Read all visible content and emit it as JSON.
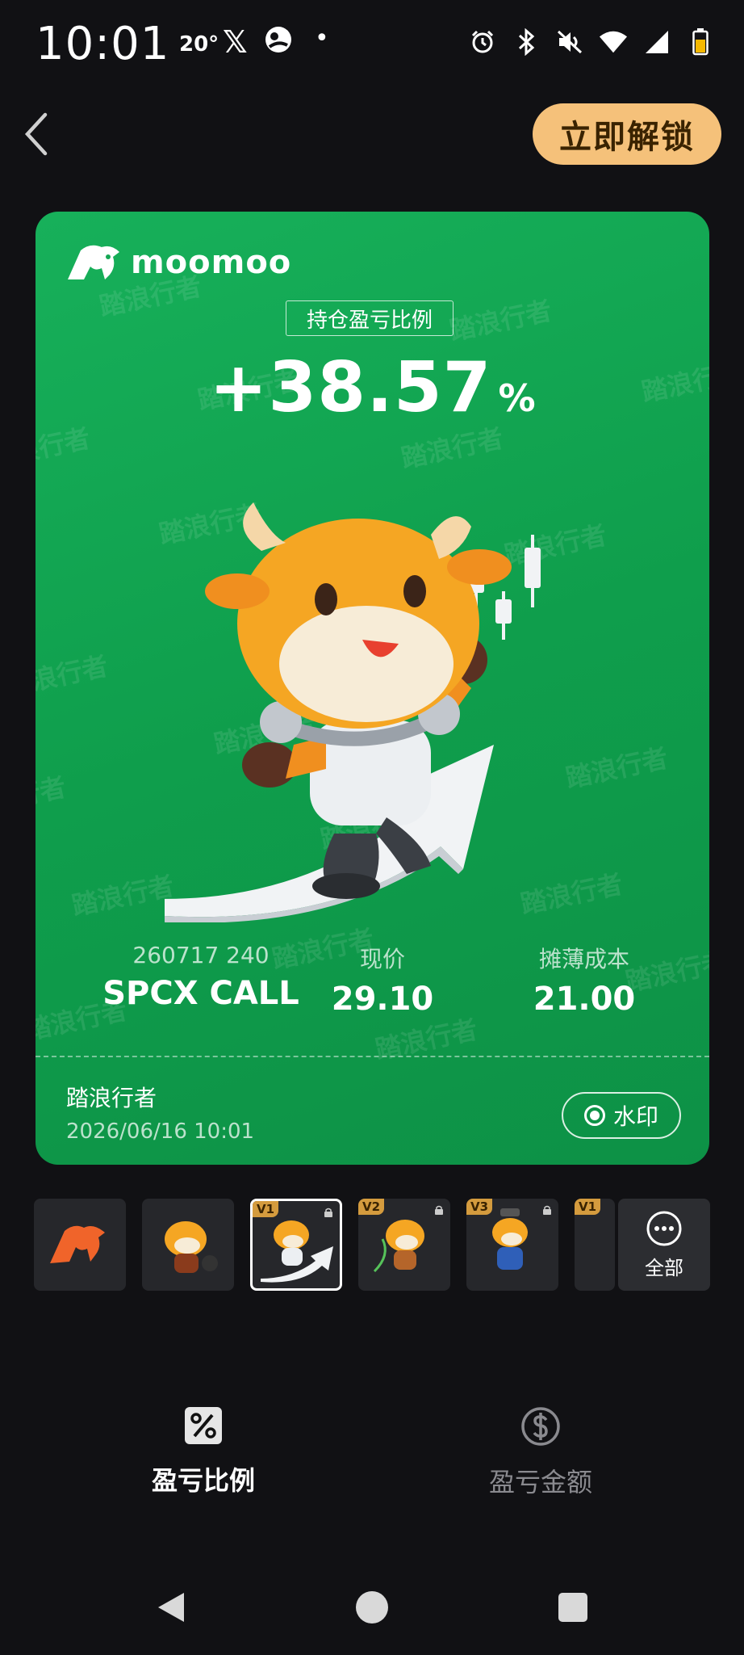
{
  "status_bar": {
    "time": "10:01",
    "temperature": "20°",
    "x_icon": "𝕏",
    "dot": "•"
  },
  "header": {
    "unlock_label": "立即解锁"
  },
  "card": {
    "brand": "moomoo",
    "ratio_label": "持仓盈亏比例",
    "ratio_value": "+38.57",
    "ratio_unit": "%",
    "watermark_text": "踏浪行者",
    "contract_code": "260717 240",
    "contract_name": "SPCX CALL",
    "current_price_label": "现价",
    "current_price": "29.10",
    "cost_label": "摊薄成本",
    "cost_value": "21.00",
    "user_name": "踏浪行者",
    "timestamp": "2026/06/16 10:01",
    "watermark_toggle_label": "水印"
  },
  "templates": {
    "items": [
      {
        "badge": ""
      },
      {
        "badge": ""
      },
      {
        "badge": "V1"
      },
      {
        "badge": "V2"
      },
      {
        "badge": "V3"
      },
      {
        "badge": "V1"
      }
    ],
    "more_label": "全部"
  },
  "tabs": {
    "ratio_label": "盈亏比例",
    "amount_label": "盈亏金额"
  },
  "colors": {
    "card_green": "#0f9e4c",
    "accent_gold": "#f5c17a",
    "background": "#111114"
  }
}
